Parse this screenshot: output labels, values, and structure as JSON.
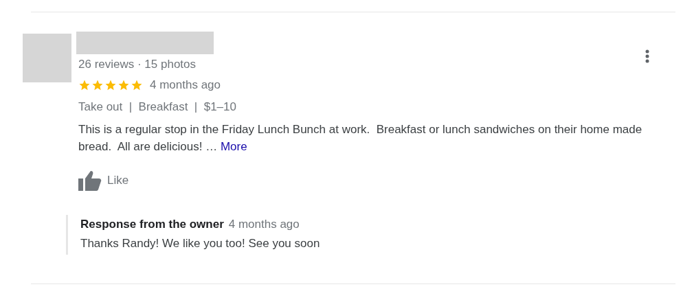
{
  "review": {
    "reviewer_stats": "26 reviews · 15 photos",
    "stars": 5,
    "time": "4 months ago",
    "details": "Take out  |  Breakfast  |  $1–10",
    "text": "This is a regular stop in the Friday Lunch Bunch at work.  Breakfast or lunch sandwiches on their home made bread.  All are delicious! …",
    "more_link": "More",
    "like_label": "Like",
    "owner_response": {
      "title": "Response from the owner",
      "time": "4 months ago",
      "text": "Thanks Randy! We like you too! See you soon"
    }
  }
}
